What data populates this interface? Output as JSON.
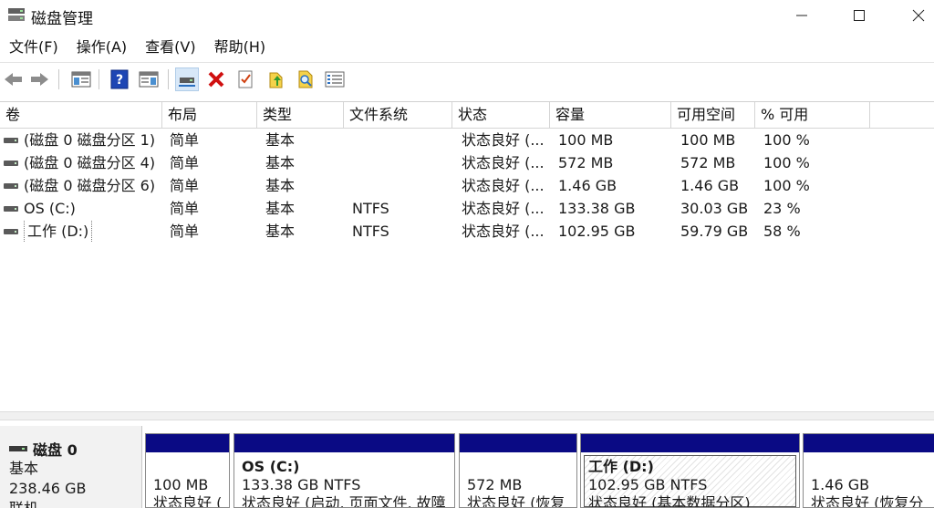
{
  "window": {
    "title": "磁盘管理"
  },
  "menu": [
    "文件(F)",
    "操作(A)",
    "查看(V)",
    "帮助(H)"
  ],
  "toolbar": [
    "back-icon",
    "forward-icon",
    "show-hide-tree-icon",
    "help-icon",
    "show-hide-action-pane-icon",
    "connect-disk-icon",
    "delete-icon",
    "properties-icon",
    "refresh-icon",
    "search-icon",
    "list-view-icon"
  ],
  "table": {
    "columns": [
      "卷",
      "布局",
      "类型",
      "文件系统",
      "状态",
      "容量",
      "可用空间",
      "% 可用"
    ],
    "rows": [
      [
        "(磁盘 0 磁盘分区 1)",
        "简单",
        "基本",
        "",
        "状态良好 (...",
        "100 MB",
        "100 MB",
        "100 %"
      ],
      [
        "(磁盘 0 磁盘分区 4)",
        "简单",
        "基本",
        "",
        "状态良好 (...",
        "572 MB",
        "572 MB",
        "100 %"
      ],
      [
        "(磁盘 0 磁盘分区 6)",
        "简单",
        "基本",
        "",
        "状态良好 (...",
        "1.46 GB",
        "1.46 GB",
        "100 %"
      ],
      [
        "OS (C:)",
        "简单",
        "基本",
        "NTFS",
        "状态良好 (...",
        "133.38 GB",
        "30.03 GB",
        "23 %"
      ],
      [
        "工作 (D:)",
        "简单",
        "基本",
        "NTFS",
        "状态良好 (...",
        "102.95 GB",
        "59.79 GB",
        "58 %"
      ]
    ]
  },
  "disk": {
    "name": "磁盘 0",
    "type": "基本",
    "size": "238.46 GB",
    "state": "联机",
    "partitions": [
      {
        "name": "",
        "size": "100 MB",
        "status": "状态良好 ("
      },
      {
        "name": "OS  (C:)",
        "size": "133.38 GB NTFS",
        "status": "状态良好 (启动, 页面文件, 故障"
      },
      {
        "name": "",
        "size": "572 MB",
        "status": "状态良好 (恢复"
      },
      {
        "name": "工作  (D:)",
        "size": "102.95 GB NTFS",
        "status": "状态良好 (基本数据分区)"
      },
      {
        "name": "",
        "size": "1.46 GB",
        "status": "状态良好 (恢复分"
      }
    ]
  },
  "colors": {
    "partition_bar": "#0a0a84",
    "accent_red": "#d01010"
  }
}
